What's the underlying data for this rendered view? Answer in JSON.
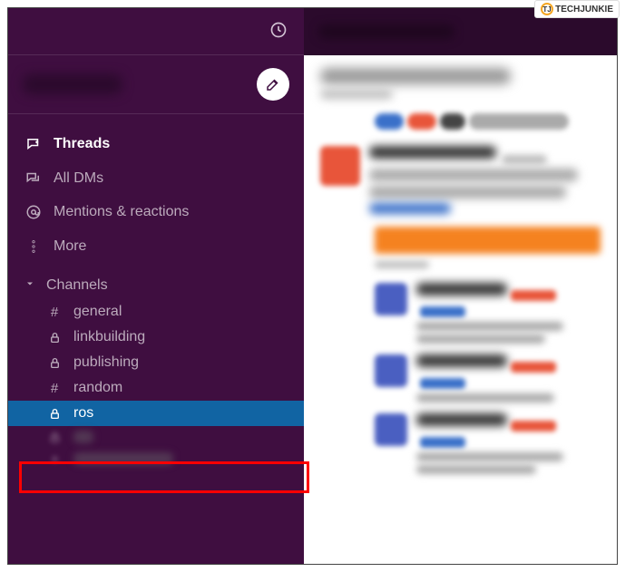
{
  "watermark": {
    "text": "TECHJUNKIE",
    "icon_letter": "TJ"
  },
  "nav": {
    "threads": "Threads",
    "dms": "All DMs",
    "mentions": "Mentions & reactions",
    "more": "More"
  },
  "sections": {
    "channels_label": "Channels"
  },
  "channels": [
    {
      "icon": "hash",
      "label": "general",
      "selected": false
    },
    {
      "icon": "lock",
      "label": "linkbuilding",
      "selected": false
    },
    {
      "icon": "lock",
      "label": "publishing",
      "selected": false
    },
    {
      "icon": "hash",
      "label": "random",
      "selected": false
    },
    {
      "icon": "lock",
      "label": "ros",
      "selected": true
    }
  ]
}
